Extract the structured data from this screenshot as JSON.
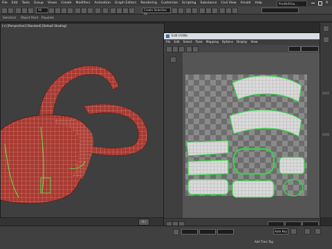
{
  "menubar": {
    "items": [
      "File",
      "Edit",
      "Tools",
      "Group",
      "Views",
      "Create",
      "Modifiers",
      "Animation",
      "Graph Editors",
      "Rendering",
      "Customize",
      "Scripting",
      "Substance",
      "Civil View",
      "Arnold",
      "Help"
    ],
    "workspace_label": "Prodik4Visa..."
  },
  "toolbar": {
    "selection_filter": "All",
    "named_selection": "Create Selection Se"
  },
  "ribbon": {
    "tabs": [
      "Selection",
      "Object Paint",
      "Populate"
    ]
  },
  "viewport": {
    "label": "[+] [Perspective] [Standard] [Default Shading]"
  },
  "uv_editor": {
    "title": "Edit UVWs",
    "menu": [
      "File",
      "Edit",
      "Select",
      "Tools",
      "Mapping",
      "Options",
      "Display",
      "View"
    ],
    "accent_color": "#37d447",
    "checker_light": "#8a8a8a",
    "checker_dark": "#6d6d6d"
  },
  "timeline": {
    "frame_readout": "0 / 100"
  },
  "statusbar": {
    "add_time_tag": "Add Time Tag",
    "auto_key": "Auto Key"
  },
  "colors": {
    "mesh_red": "#a83a32",
    "mesh_wire": "#e8c8c2",
    "selection_green": "#5fe04a"
  }
}
